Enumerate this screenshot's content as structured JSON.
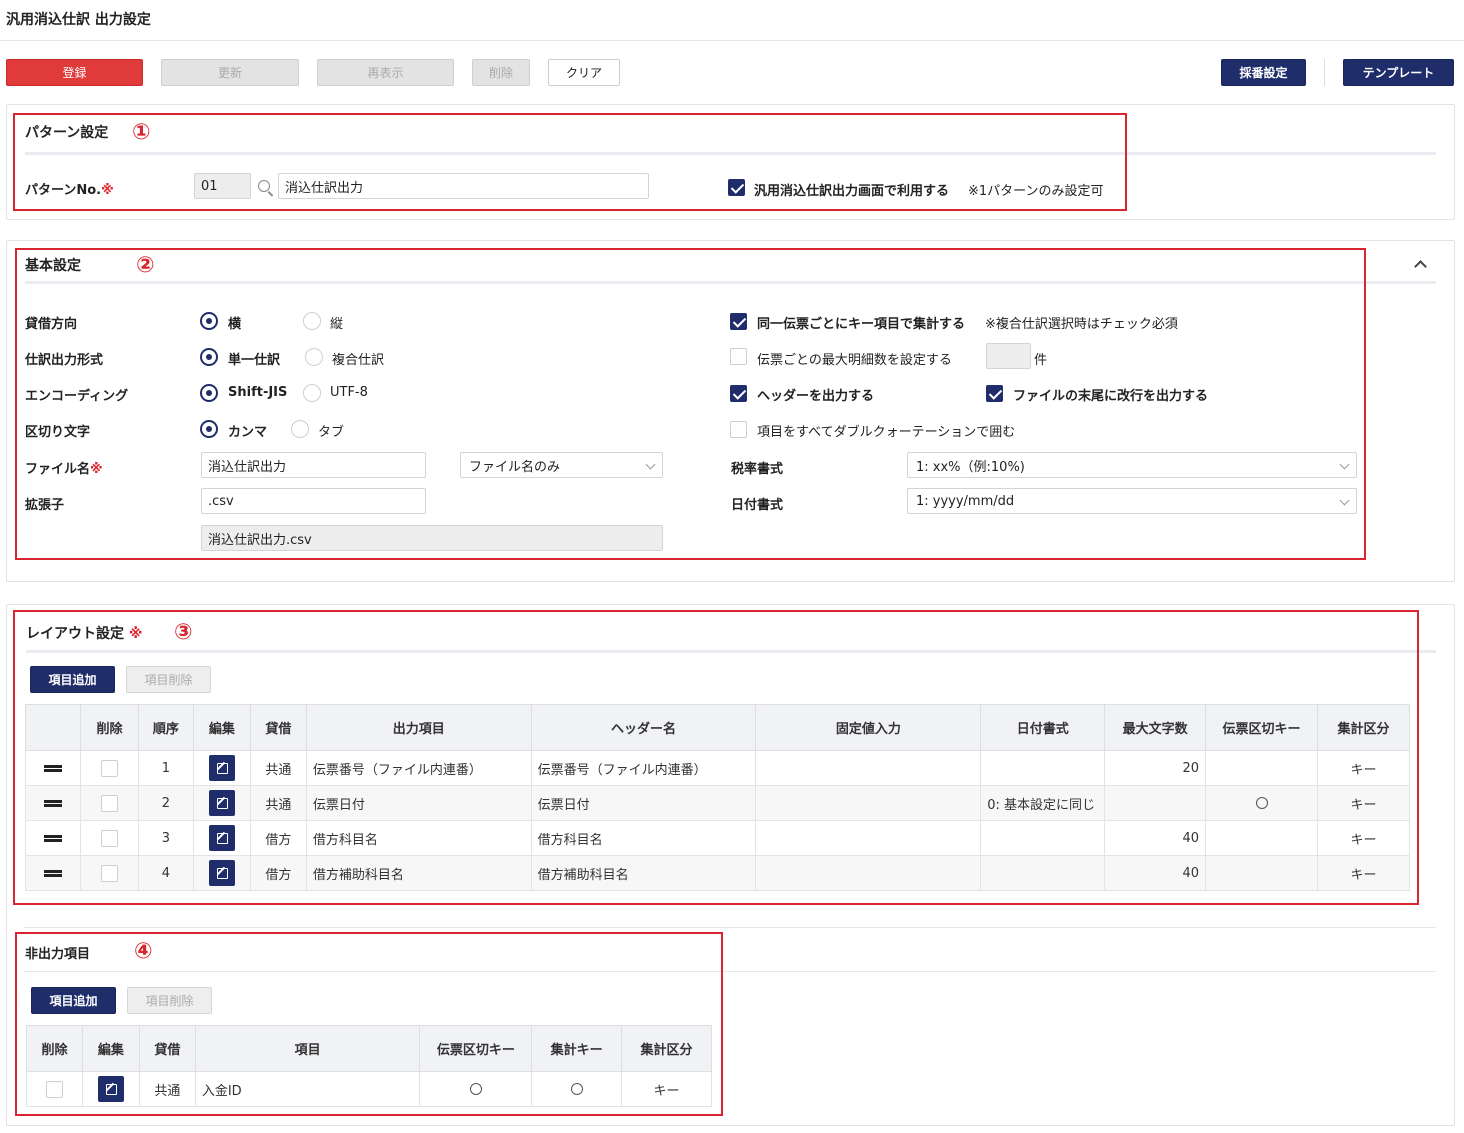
{
  "page_title": "汎用消込仕訳 出力設定",
  "toolbar": {
    "register": "登録",
    "update": "更新",
    "redisplay": "再表示",
    "delete": "削除",
    "clear": "クリア",
    "numbering": "採番設定",
    "template": "テンプレート"
  },
  "pattern": {
    "section_title": "パターン設定",
    "marker": "①",
    "label": "パターンNo.",
    "required_mark": "※",
    "number": "01",
    "name": "消込仕訳出力",
    "use_checkbox_label": "汎用消込仕訳出力画面で利用する",
    "note": "※1パターンのみ設定可",
    "use_checked": true
  },
  "basic": {
    "section_title": "基本設定",
    "marker": "②",
    "debit_credit": {
      "label": "貸借方向",
      "opt1": "横",
      "opt2": "縦"
    },
    "journal_format": {
      "label": "仕訳出力形式",
      "opt1": "単一仕訳",
      "opt2": "複合仕訳"
    },
    "encoding": {
      "label": "エンコーディング",
      "opt1": "Shift-JIS",
      "opt2": "UTF-8"
    },
    "delimiter": {
      "label": "区切り文字",
      "opt1": "カンマ",
      "opt2": "タブ"
    },
    "filename": {
      "label": "ファイル名",
      "value": "消込仕訳出力",
      "select": "ファイル名のみ"
    },
    "extension": {
      "label": "拡張子",
      "value": ".csv",
      "preview": "消込仕訳出力.csv"
    },
    "aggregate_key": {
      "label": "同一伝票ごとにキー項目で集計する",
      "note": "※複合仕訳選択時はチェック必須"
    },
    "max_detail": {
      "label": "伝票ごとの最大明細数を設定する",
      "unit": "件"
    },
    "output_header": "ヘッダーを出力する",
    "newline_end": "ファイルの末尾に改行を出力する",
    "double_quote": "項目をすべてダブルクォーテーションで囲む",
    "tax_format": {
      "label": "税率書式",
      "value": "1: xx%（例:10%)"
    },
    "date_format": {
      "label": "日付書式",
      "value": "1: yyyy/mm/dd"
    }
  },
  "layout": {
    "section_title": "レイアウト設定",
    "marker": "③",
    "add_button": "項目追加",
    "delete_button": "項目削除",
    "headers": [
      "",
      "削除",
      "順序",
      "編集",
      "貸借",
      "出力項目",
      "ヘッダー名",
      "固定値入力",
      "日付書式",
      "最大文字数",
      "伝票区切キー",
      "集計区分"
    ],
    "rows": [
      {
        "order": "1",
        "dc": "共通",
        "item": "伝票番号（ファイル内連番）",
        "header": "伝票番号（ファイル内連番）",
        "fixed": "",
        "date": "",
        "maxlen": "20",
        "split": false,
        "agg": "キー"
      },
      {
        "order": "2",
        "dc": "共通",
        "item": "伝票日付",
        "header": "伝票日付",
        "fixed": "",
        "date": "0: 基本設定に同じ",
        "maxlen": "",
        "split": true,
        "agg": "キー"
      },
      {
        "order": "3",
        "dc": "借方",
        "item": "借方科目名",
        "header": "借方科目名",
        "fixed": "",
        "date": "",
        "maxlen": "40",
        "split": false,
        "agg": "キー"
      },
      {
        "order": "4",
        "dc": "借方",
        "item": "借方補助科目名",
        "header": "借方補助科目名",
        "fixed": "",
        "date": "",
        "maxlen": "40",
        "split": false,
        "agg": "キー"
      }
    ]
  },
  "non_output": {
    "section_title": "非出力項目",
    "marker": "④",
    "add_button": "項目追加",
    "delete_button": "項目削除",
    "headers": [
      "削除",
      "編集",
      "貸借",
      "項目",
      "伝票区切キー",
      "集計キー",
      "集計区分"
    ],
    "rows": [
      {
        "dc": "共通",
        "item": "入金ID",
        "agg": "キー"
      }
    ]
  }
}
